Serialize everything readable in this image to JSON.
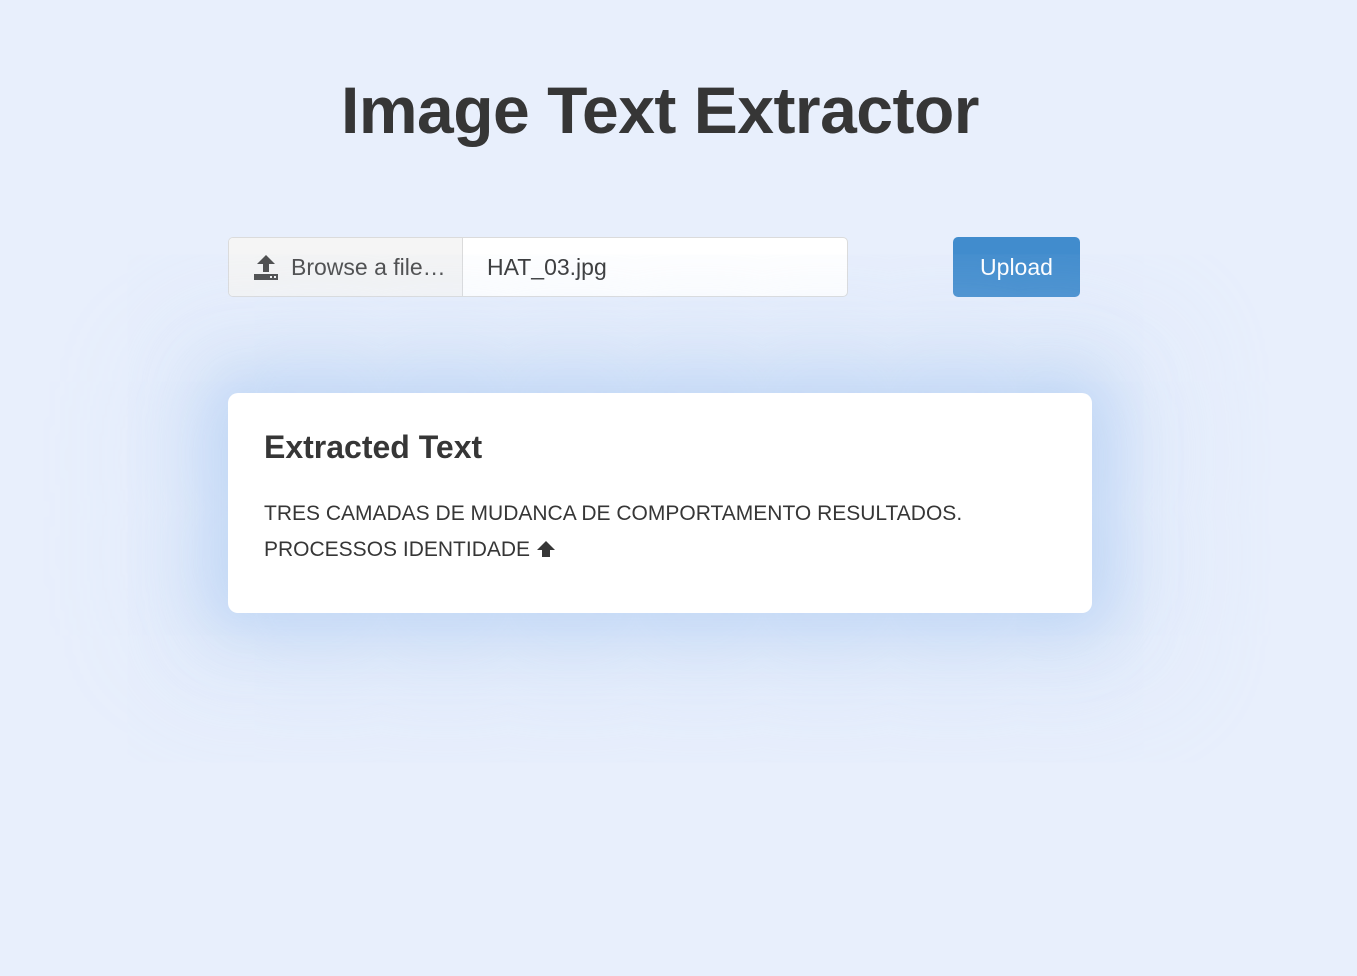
{
  "header": {
    "title": "Image Text Extractor"
  },
  "upload_form": {
    "browse_label": "Browse a file…",
    "browse_icon": "upload-icon",
    "file_name": "HAT_03.jpg",
    "upload_label": "Upload"
  },
  "result": {
    "heading": "Extracted Text",
    "text": "TRES CAMADAS DE MUDANCA DE COMPORTAMENTO RESULTADOS. PROCESSOS IDENTIDADE",
    "trailing_icon": "arrow-up-icon"
  },
  "colors": {
    "background": "#e8effc",
    "button": "#418ccd",
    "text": "#363636",
    "card": "#ffffff"
  }
}
